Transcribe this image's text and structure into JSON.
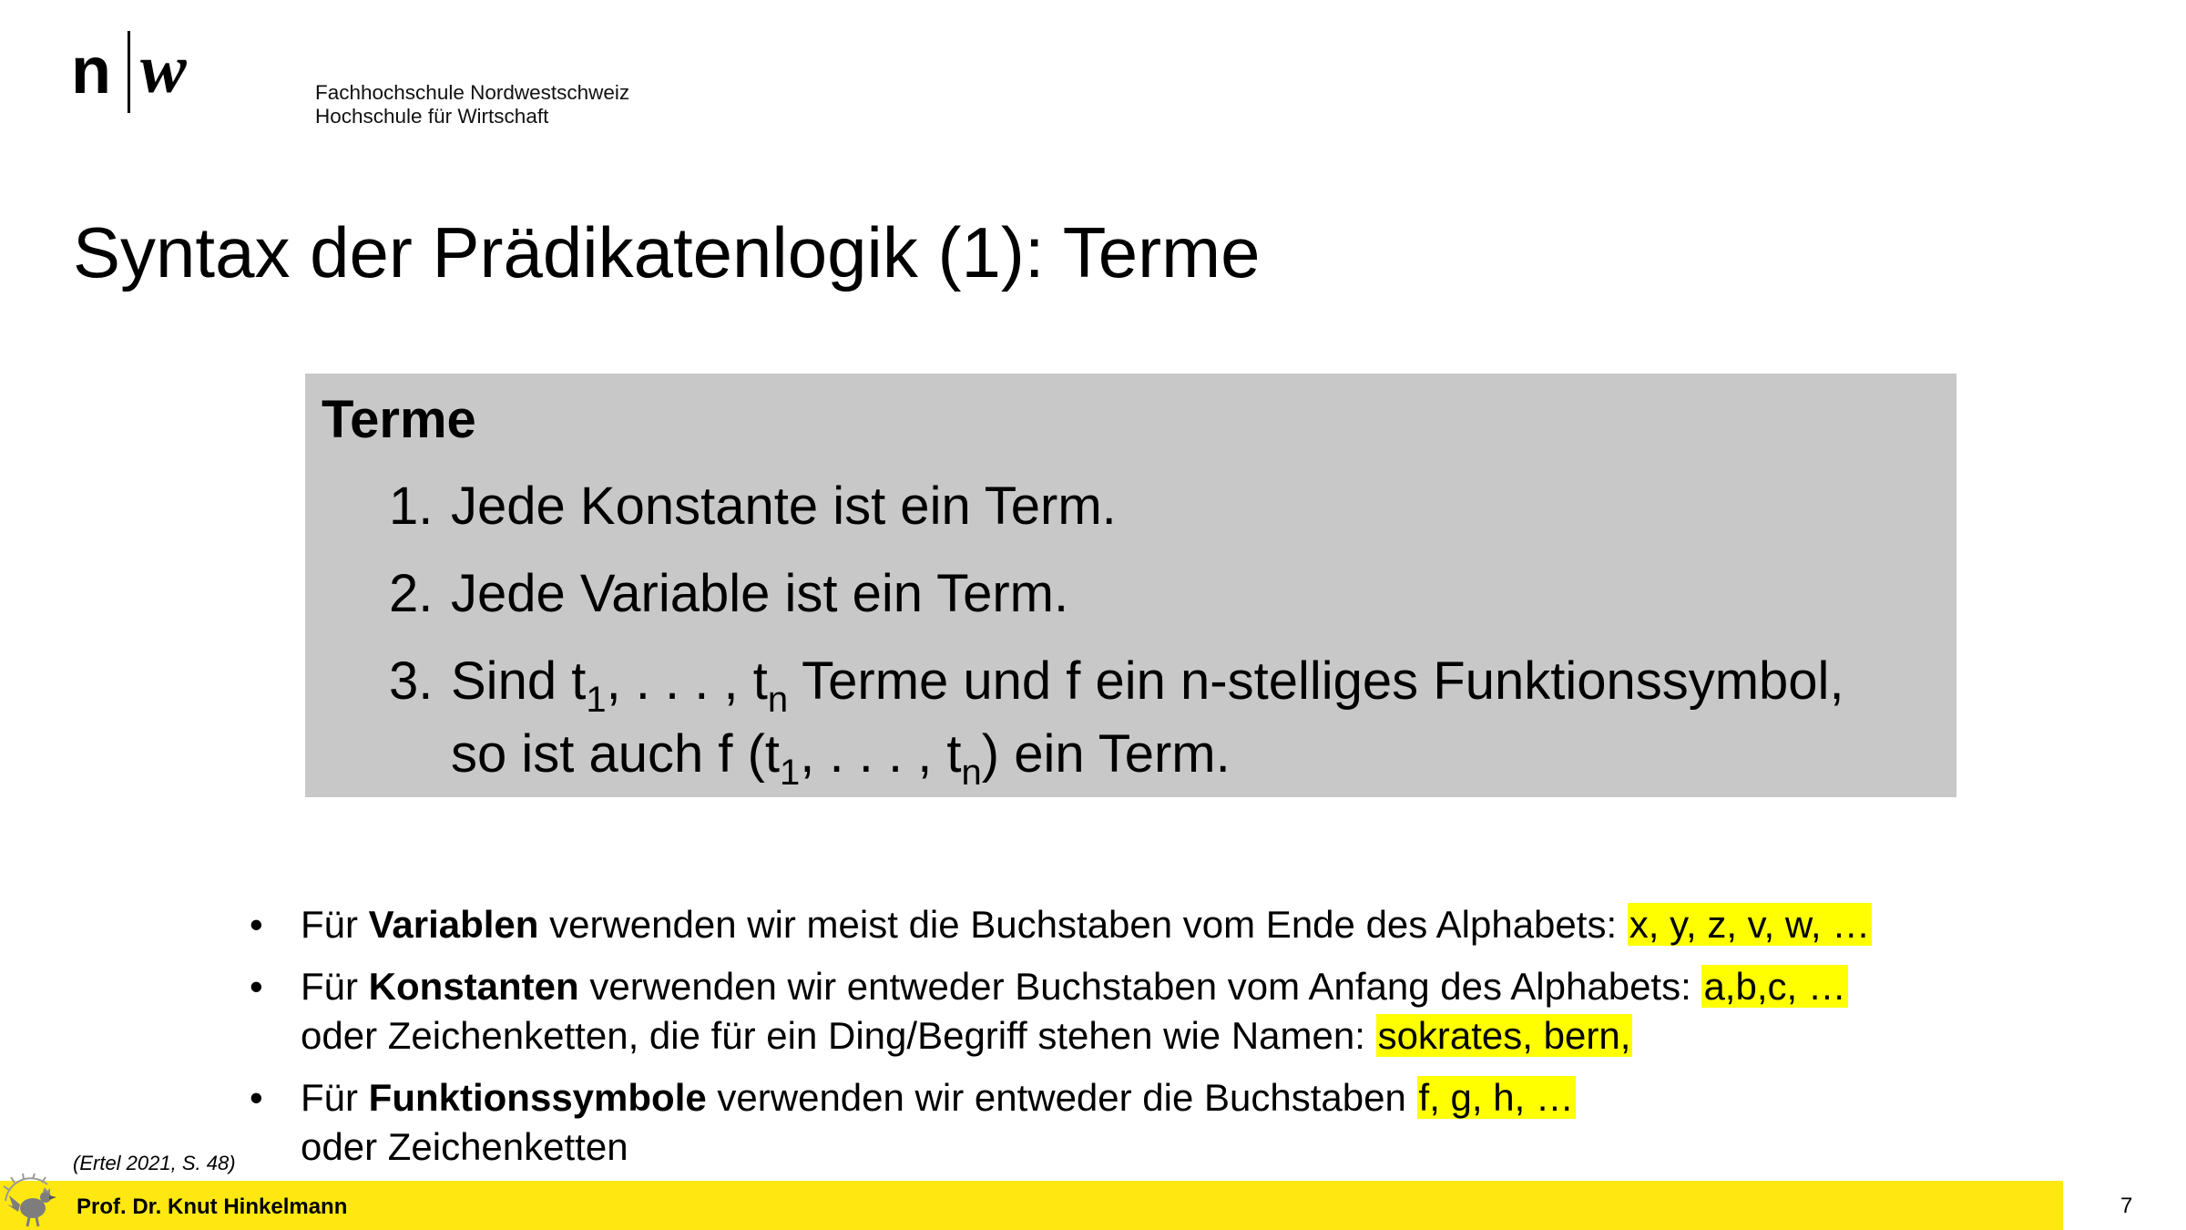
{
  "header": {
    "logo_n": "n",
    "logo_w": "w",
    "institution_line1": "Fachhochschule Nordwestschweiz",
    "institution_line2": "Hochschule für Wirtschaft"
  },
  "title": "Syntax der Prädikatenlogik (1): Terme",
  "definition": {
    "heading": "Terme",
    "item1_num": "1.",
    "item1_text": "Jede Konstante ist ein Term.",
    "item2_num": "2.",
    "item2_text": "Jede Variable ist ein Term.",
    "item3_num": "3.",
    "item3_part1": "Sind t",
    "item3_sub1": "1",
    "item3_part2": ", . . . , t",
    "item3_sub2": "n",
    "item3_part3": " Terme und f ein n-stelliges Funktionssymbol,",
    "item3_line2_part1": "so ist auch f (t",
    "item3_line2_sub1": "1",
    "item3_line2_part2": ", . . . , t",
    "item3_line2_sub2": "n",
    "item3_line2_part3": ") ein Term."
  },
  "bullets": {
    "b1_pre": "Für ",
    "b1_bold": "Variablen",
    "b1_text": " verwenden wir meist die Buchstaben vom Ende des Alphabets: ",
    "b1_highlight": "x, y, z, v, w, …",
    "b2_pre": "Für ",
    "b2_bold": "Konstanten",
    "b2_text": " verwenden wir entweder Buchstaben vom Anfang des Alphabets: ",
    "b2_highlight": "a,b,c, …",
    "b2_line2": "oder Zeichenketten, die für ein Ding/Begriff stehen wie Namen: ",
    "b2_line2_highlight": "sokrates, bern,",
    "b3_pre": "Für ",
    "b3_bold": "Funktionssymbole",
    "b3_text": " verwenden wir entweder die Buchstaben ",
    "b3_highlight": "f, g, h, …",
    "b3_line2": "oder Zeichenketten"
  },
  "source": "(Ertel 2021, S. 48)",
  "footer": {
    "author": "Prof. Dr. Knut Hinkelmann",
    "page_number": "7",
    "bar_color": "#ffe812",
    "highlight_color": "#ffff00",
    "icon": "rooster-icon"
  }
}
